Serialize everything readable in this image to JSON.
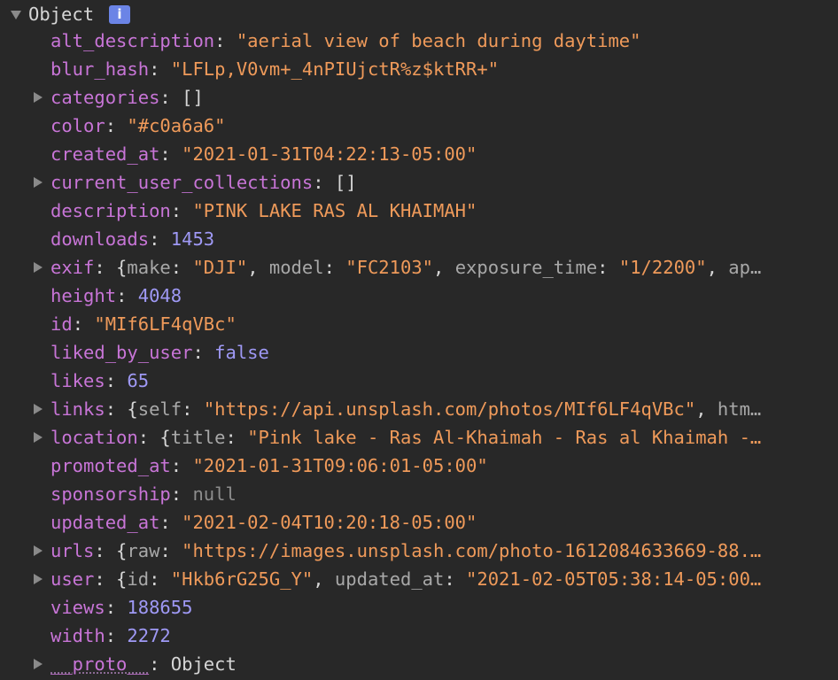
{
  "root": {
    "label": "Object",
    "info_glyph": "i"
  },
  "props": {
    "alt_description": {
      "key": "alt_description",
      "value": "\"aerial view of beach during daytime\""
    },
    "blur_hash": {
      "key": "blur_hash",
      "value": "\"LFLp,V0vm+_4nPIUjctR%z$ktRR+\""
    },
    "categories": {
      "key": "categories",
      "value": "[]"
    },
    "color": {
      "key": "color",
      "value": "\"#c0a6a6\""
    },
    "created_at": {
      "key": "created_at",
      "value": "\"2021-01-31T04:22:13-05:00\""
    },
    "current_user_collections": {
      "key": "current_user_collections",
      "value": "[]"
    },
    "description": {
      "key": "description",
      "value": "\"PINK LAKE RAS AL KHAIMAH\""
    },
    "downloads": {
      "key": "downloads",
      "value": "1453"
    },
    "exif": {
      "key": "exif",
      "k1": "make",
      "v1": "\"DJI\"",
      "k2": "model",
      "v2": "\"FC2103\"",
      "k3": "exposure_time",
      "v3": "\"1/2200\"",
      "k4": "ap…"
    },
    "height": {
      "key": "height",
      "value": "4048"
    },
    "id": {
      "key": "id",
      "value": "\"MIf6LF4qVBc\""
    },
    "liked_by_user": {
      "key": "liked_by_user",
      "value": "false"
    },
    "likes": {
      "key": "likes",
      "value": "65"
    },
    "links": {
      "key": "links",
      "k1": "self",
      "v1": "\"https://api.unsplash.com/photos/MIf6LF4qVBc\"",
      "k2": "htm…"
    },
    "location": {
      "key": "location",
      "k1": "title",
      "v1": "\"Pink lake - Ras Al-Khaimah - Ras al Khaimah -…"
    },
    "promoted_at": {
      "key": "promoted_at",
      "value": "\"2021-01-31T09:06:01-05:00\""
    },
    "sponsorship": {
      "key": "sponsorship",
      "value": "null"
    },
    "updated_at": {
      "key": "updated_at",
      "value": "\"2021-02-04T10:20:18-05:00\""
    },
    "urls": {
      "key": "urls",
      "k1": "raw",
      "v1": "\"https://images.unsplash.com/photo-1612084633669-88.…"
    },
    "user": {
      "key": "user",
      "k1": "id",
      "v1": "\"Hkb6rG25G_Y\"",
      "k2": "updated_at",
      "v2": "\"2021-02-05T05:38:14-05:00…"
    },
    "views": {
      "key": "views",
      "value": "188655"
    },
    "width": {
      "key": "width",
      "value": "2272"
    },
    "proto": {
      "key": "__proto__",
      "value": "Object"
    }
  },
  "colors": {
    "background": "#282828",
    "key": "#c875d7",
    "string": "#ef9a5a",
    "number": "#9f99f5",
    "null": "#8d8d8d",
    "inner_key": "#a8a8a8",
    "punctuation": "#d6d6d6",
    "info_badge": "#6b84e6"
  }
}
